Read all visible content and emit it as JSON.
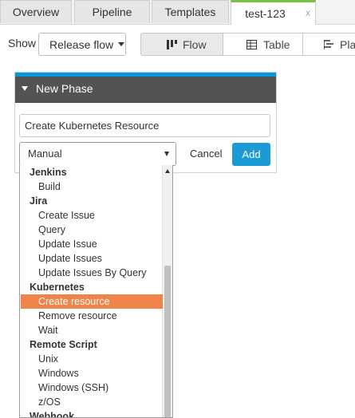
{
  "tabs": [
    {
      "label": "Overview"
    },
    {
      "label": "Pipeline"
    },
    {
      "label": "Templates"
    },
    {
      "label": "test-123",
      "close": "x"
    }
  ],
  "toolbar": {
    "show_label": "Show",
    "view_select": "Release flow",
    "views": [
      {
        "label": "Flow",
        "icon": "flow-icon"
      },
      {
        "label": "Table",
        "icon": "table-icon"
      },
      {
        "label": "Plan",
        "icon": "plan-icon"
      }
    ]
  },
  "phase_panel": {
    "title": "New Phase",
    "task_title_value": "Create Kubernetes Resource",
    "task_type_selected": "Manual",
    "cancel_label": "Cancel",
    "add_label": "Add"
  },
  "dropdown": {
    "items": [
      {
        "label": "Jenkins",
        "kind": "group"
      },
      {
        "label": "Build",
        "kind": "option"
      },
      {
        "label": "Jira",
        "kind": "group"
      },
      {
        "label": "Create Issue",
        "kind": "option"
      },
      {
        "label": "Query",
        "kind": "option"
      },
      {
        "label": "Update Issue",
        "kind": "option"
      },
      {
        "label": "Update Issues",
        "kind": "option"
      },
      {
        "label": "Update Issues By Query",
        "kind": "option"
      },
      {
        "label": "Kubernetes",
        "kind": "group"
      },
      {
        "label": "Create resource",
        "kind": "option",
        "selected": true
      },
      {
        "label": "Remove resource",
        "kind": "option"
      },
      {
        "label": "Wait",
        "kind": "option"
      },
      {
        "label": "Remote Script",
        "kind": "group"
      },
      {
        "label": "Unix",
        "kind": "option"
      },
      {
        "label": "Windows",
        "kind": "option"
      },
      {
        "label": "Windows (SSH)",
        "kind": "option"
      },
      {
        "label": "z/OS",
        "kind": "option"
      },
      {
        "label": "Webhook",
        "kind": "group"
      }
    ]
  },
  "colors": {
    "active_tab_accent": "#7ac143",
    "panel_accent": "#0098d9",
    "panel_header": "#535353",
    "add_button": "#1b9ad6",
    "highlight": "#f0834a"
  }
}
